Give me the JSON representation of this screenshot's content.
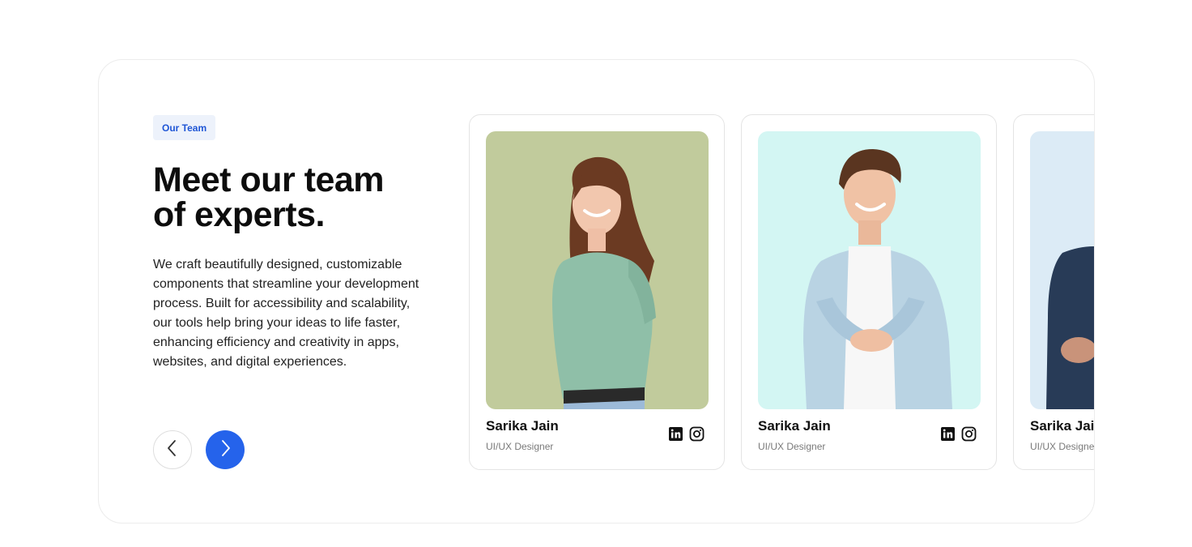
{
  "section": {
    "badge": "Our Team",
    "title": "Meet our team of experts.",
    "description": "We craft beautifully designed, customizable components that streamline your development process. Built for accessibility and scalability, our tools help bring your ideas to life faster, enhancing efficiency and creativity in apps, websites, and digital experiences."
  },
  "nav": {
    "prev_icon": "chevron-left-icon",
    "next_icon": "chevron-right-icon"
  },
  "colors": {
    "accent": "#2563eb",
    "badge_bg": "#edf2fb",
    "badge_text": "#1f56d6"
  },
  "members": [
    {
      "name": "Sarika Jain",
      "role": "UI/UX Designer",
      "photo_bg": "#c1cb9c"
    },
    {
      "name": "Sarika Jain",
      "role": "UI/UX Designer",
      "photo_bg": "#d3f6f3"
    },
    {
      "name": "Sarika Jain",
      "role": "UI/UX Designer",
      "photo_bg": "#dcebf6"
    }
  ],
  "social_icons": [
    "linkedin-icon",
    "instagram-icon"
  ]
}
